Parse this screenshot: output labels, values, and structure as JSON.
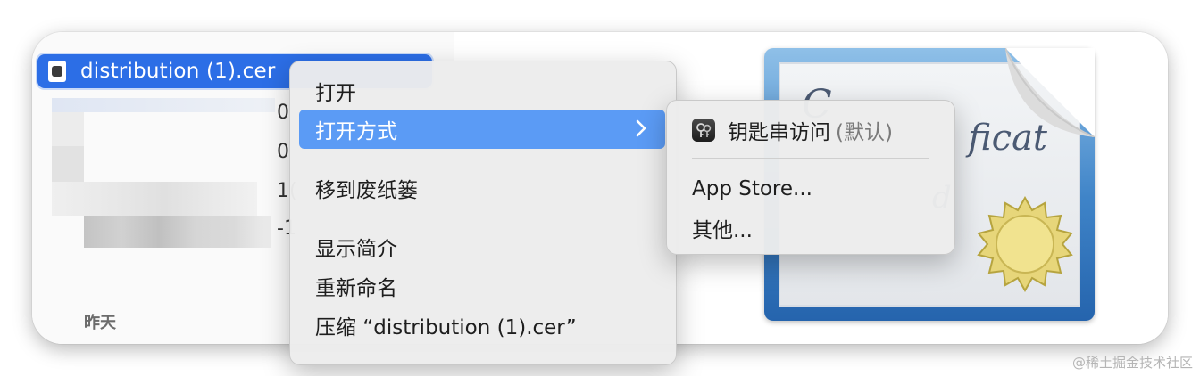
{
  "finder": {
    "selected_file": "distribution (1).cer",
    "row_fragments": [
      "0",
      "0",
      "1(",
      "-1"
    ],
    "date_group": "昨天"
  },
  "context_menu": {
    "items": [
      {
        "label": "打开"
      },
      {
        "label": "打开方式",
        "highlighted": true
      },
      {
        "label": "移到废纸篓"
      },
      {
        "label": "显示简介"
      },
      {
        "label": "重新命名"
      },
      {
        "label": "压缩 “distribution (1).cer”"
      }
    ]
  },
  "submenu": {
    "default_app": "钥匙串访问",
    "default_suffix": "(默认)",
    "items": [
      {
        "label": "App Store..."
      },
      {
        "label": "其他..."
      }
    ]
  },
  "watermark": "@稀土掘金技术社区",
  "colors": {
    "selection": "#2c6ee6",
    "menu_highlight": "#5b9bf5"
  }
}
